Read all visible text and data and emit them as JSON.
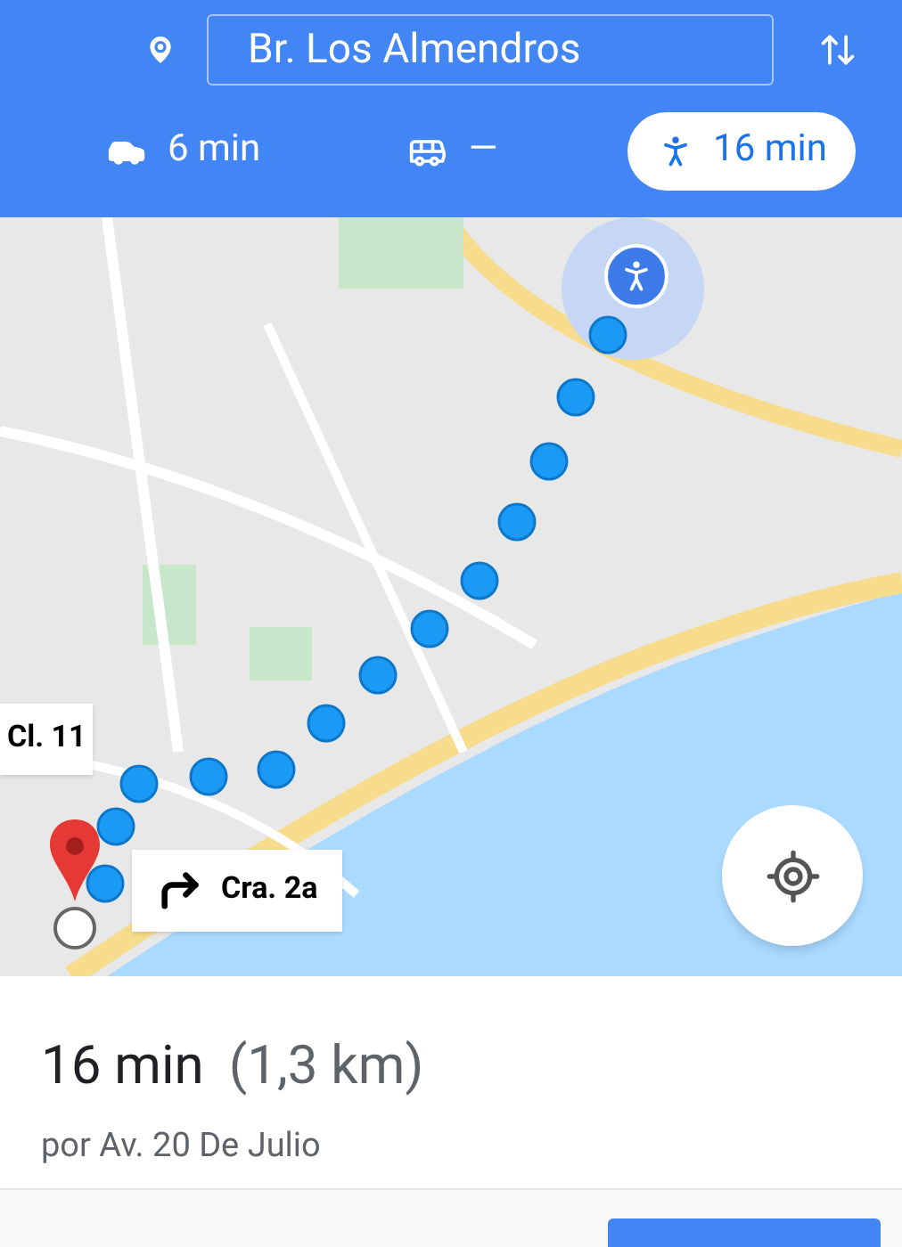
{
  "destination": {
    "value": "Br. Los Almendros"
  },
  "modes": [
    {
      "kind": "car",
      "label": "6 min",
      "selected": false
    },
    {
      "kind": "transit",
      "label": "—",
      "selected": false
    },
    {
      "kind": "walk",
      "label": "16 min",
      "selected": true
    }
  ],
  "map": {
    "kind": "picture",
    "callouts": [
      {
        "kind": "street",
        "label": "Cl. 11"
      },
      {
        "kind": "turn",
        "label": "Cra. 2a"
      }
    ]
  },
  "summary": {
    "duration": "16 min",
    "distance": "(1,3 km)",
    "via": "por Av. 20 De Julio"
  }
}
